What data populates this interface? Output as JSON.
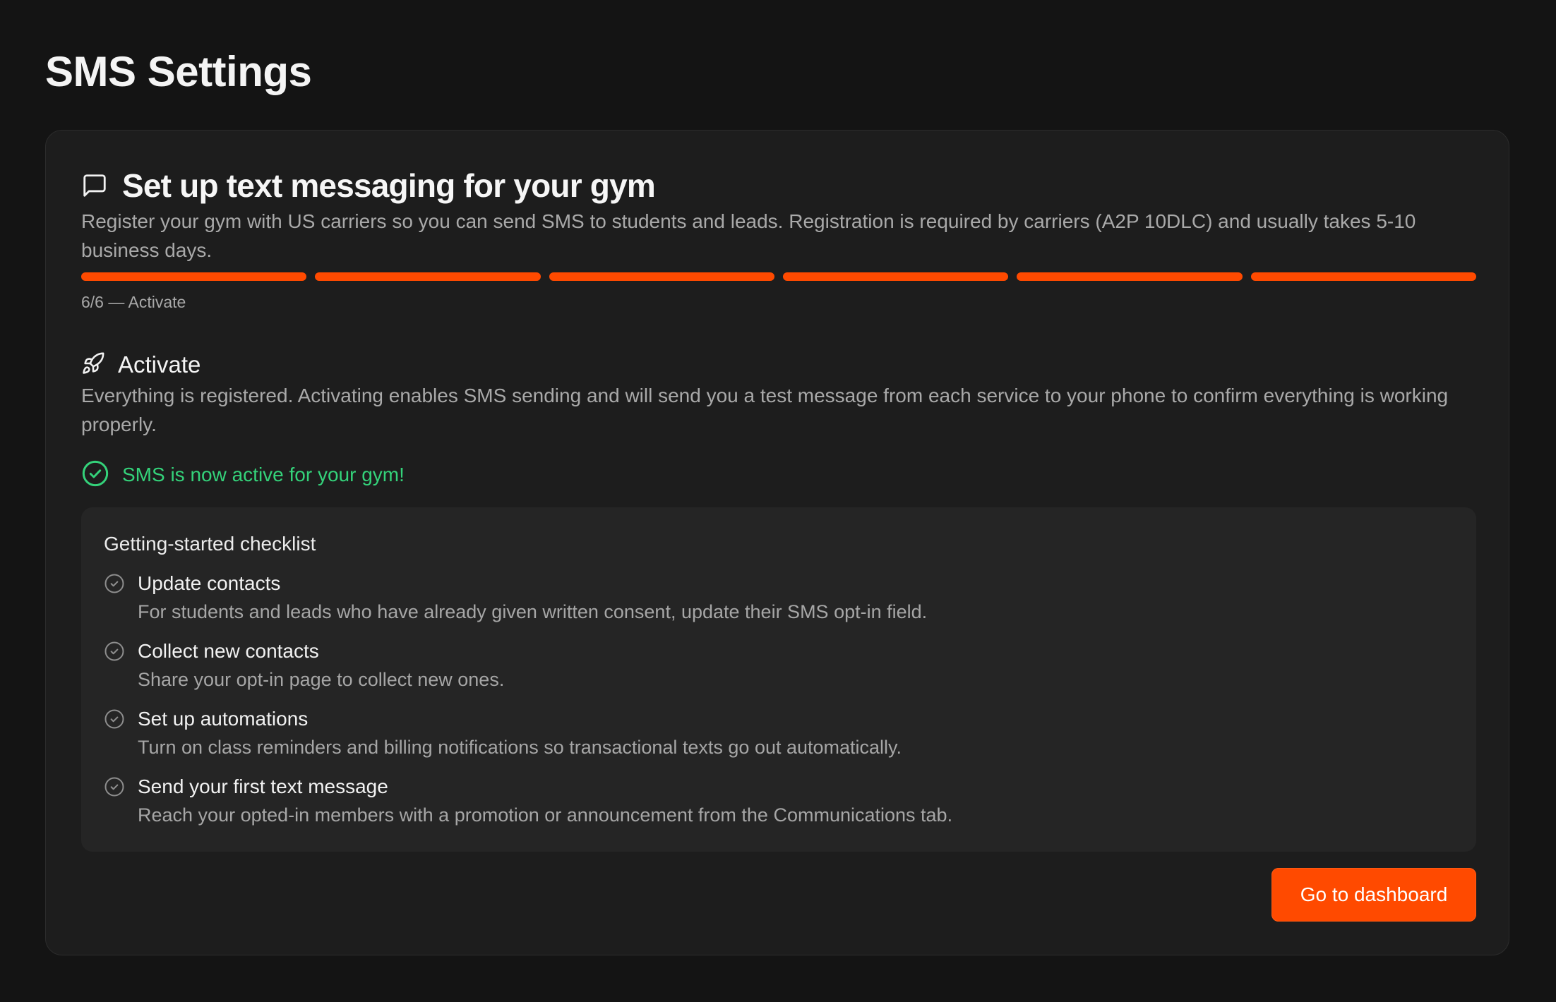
{
  "page": {
    "title": "SMS Settings"
  },
  "card": {
    "title": "Set up text messaging for your gym",
    "description": "Register your gym with US carriers so you can send SMS to students and leads. Registration is required by carriers (A2P 10DLC) and usually takes 5-10 business days.",
    "icon": "message-square-icon"
  },
  "progress": {
    "current_step": 6,
    "total_steps": 6,
    "label": "6/6 — Activate",
    "accent_color": "#ff4a00"
  },
  "section": {
    "icon": "rocket-icon",
    "title": "Activate",
    "description": "Everything is registered. Activating enables SMS sending and will send you a test message from each service to your phone to confirm everything is working properly."
  },
  "status": {
    "icon": "check-circle-icon",
    "text": "SMS is now active for your gym!",
    "color": "#34d27a"
  },
  "checklist": {
    "title": "Getting-started checklist",
    "items": [
      {
        "title": "Update contacts",
        "description": "For students and leads who have already given written consent, update their SMS opt-in field."
      },
      {
        "title": "Collect new contacts",
        "description": "Share your opt-in page to collect new ones."
      },
      {
        "title": "Set up automations",
        "description": "Turn on class reminders and billing notifications so transactional texts go out automatically."
      },
      {
        "title": "Send your first text message",
        "description": "Reach your opted-in members with a promotion or announcement from the Communications tab."
      }
    ]
  },
  "actions": {
    "primary_label": "Go to dashboard"
  }
}
